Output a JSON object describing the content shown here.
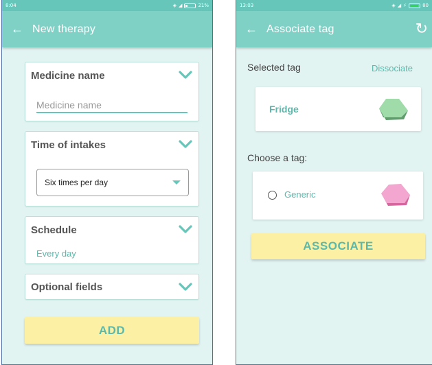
{
  "left": {
    "status": {
      "time": "8:04",
      "battery": "21%"
    },
    "app_bar": {
      "title": "New therapy"
    },
    "medicine_card": {
      "title": "Medicine name",
      "placeholder": "Medicine name"
    },
    "intakes_card": {
      "title": "Time of intakes",
      "selected": "Six times per day"
    },
    "schedule_card": {
      "title": "Schedule",
      "value": "Every day"
    },
    "optional_card": {
      "title": "Optional fields"
    },
    "add_button": "ADD"
  },
  "right": {
    "status": {
      "time": "13:03",
      "battery": "80"
    },
    "app_bar": {
      "title": "Associate tag"
    },
    "selected_label": "Selected tag",
    "dissociate": "Dissociate",
    "selected_tag": {
      "name": "Fridge",
      "color": "#8fcf9e"
    },
    "choose_label": "Choose a tag:",
    "option": {
      "name": "Generic",
      "color": "#ee99c4"
    },
    "associate_button": "ASSOCIATE"
  },
  "colors": {
    "accent": "#65c6b9",
    "app_bar": "#7fd1c6",
    "background": "#e2f4f2",
    "button": "#fbf0a3"
  }
}
